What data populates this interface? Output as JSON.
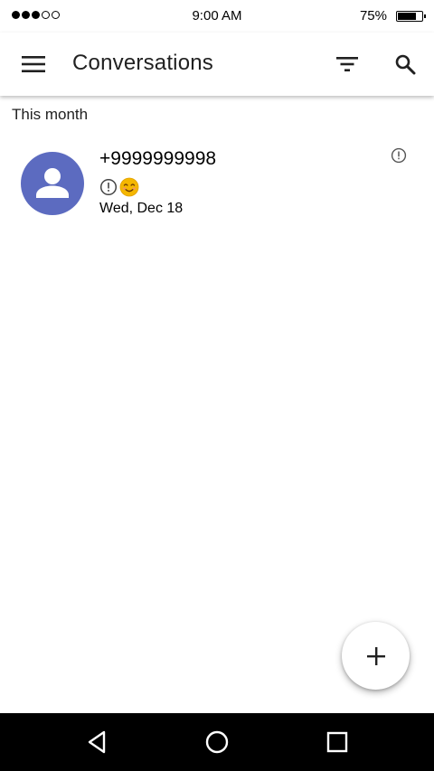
{
  "status_bar": {
    "time": "9:00 AM",
    "battery_percent": "75%",
    "battery_level": 0.75,
    "signal_bars_filled": 3,
    "signal_bars_total": 5
  },
  "app_bar": {
    "title": "Conversations",
    "icons": [
      "menu-icon",
      "filter-icon",
      "search-icon"
    ]
  },
  "sections": [
    {
      "header": "This month",
      "conversations": [
        {
          "name": "+9999999998",
          "snippet_icons": [
            "error-icon",
            "smiling-emoji-icon"
          ],
          "date": "Wed, Dec 18",
          "status_icon": "error-icon"
        }
      ]
    }
  ],
  "fab": {
    "icon": "plus-icon"
  },
  "nav_bar": {
    "icons": [
      "back-icon",
      "home-icon",
      "recents-icon"
    ]
  },
  "colors": {
    "avatar": "#5c6bc0",
    "nav_bar": "#000000",
    "app_bar": "#ffffff",
    "emoji": "#f5b700"
  }
}
